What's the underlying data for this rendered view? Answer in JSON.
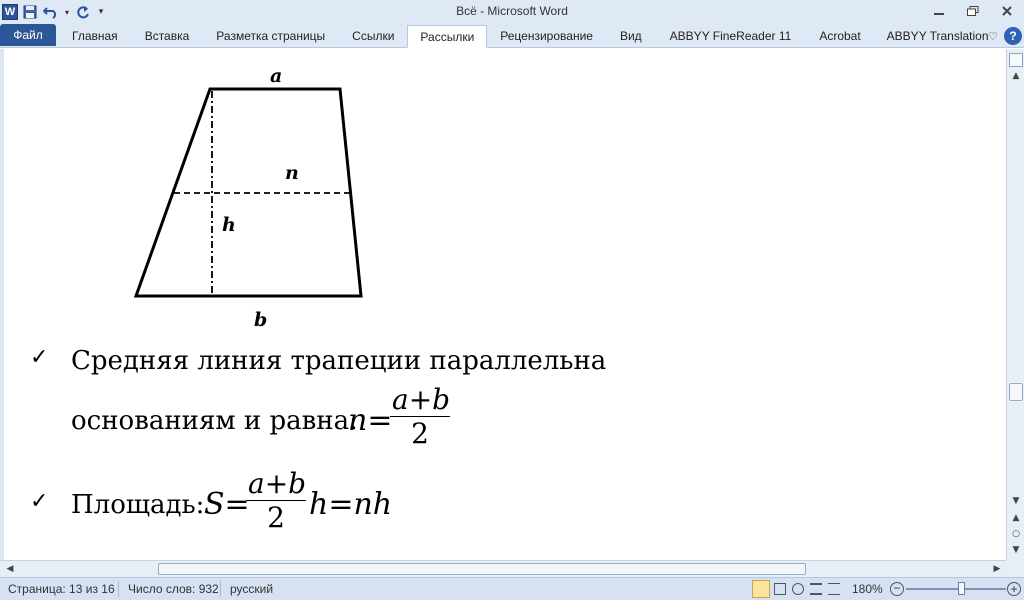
{
  "window": {
    "title": "Всё  -  Microsoft Word"
  },
  "quick_access": {
    "logo_letter": "W"
  },
  "tabs": [
    {
      "label": "Файл"
    },
    {
      "label": "Главная"
    },
    {
      "label": "Вставка"
    },
    {
      "label": "Разметка страницы"
    },
    {
      "label": "Ссылки"
    },
    {
      "label": "Рассылки"
    },
    {
      "label": "Рецензирование"
    },
    {
      "label": "Вид"
    },
    {
      "label": "ABBYY FineReader 11"
    },
    {
      "label": "Acrobat"
    },
    {
      "label": "ABBYY Translation"
    }
  ],
  "active_tab": "Рассылки",
  "figure": {
    "label_a": "a",
    "label_b": "b",
    "label_n": "n",
    "label_h": "h"
  },
  "content": {
    "bullet1_line1": "Средняя линия трапеции параллельна",
    "bullet1_line2": "основаниям и равна:",
    "bullet2_prefix": "Площадь:",
    "n_lhs": "n=",
    "frac_num": "a+b",
    "frac_den": "2",
    "s_lhs": "S=",
    "s_rhs": "h=nh",
    "check_glyph": "✓"
  },
  "status": {
    "page": "Страница: 13 из 16",
    "words": "Число слов: 932",
    "language": "русский",
    "zoom": "180%"
  },
  "colors": {
    "accent": "#2b5797",
    "chrome": "#dfe9f5",
    "status": "#d6e2f1"
  }
}
